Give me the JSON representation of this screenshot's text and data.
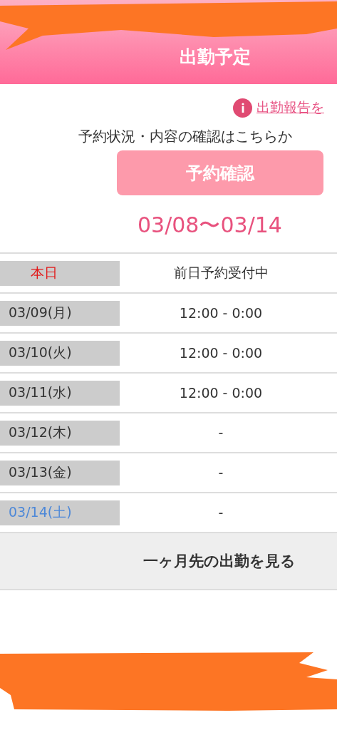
{
  "header": {
    "title": "出勤予定"
  },
  "notice": {
    "link": "出勤報告を"
  },
  "reservation": {
    "text": "予約状況・内容の確認はこちらか",
    "button": "予約確認"
  },
  "week_range": "03/08〜03/14",
  "schedule": [
    {
      "kind": "today",
      "date": "本日",
      "time": "前日予約受付中"
    },
    {
      "kind": "weekday",
      "date": "03/09(月)",
      "time": "12:00 - 0:00"
    },
    {
      "kind": "weekday",
      "date": "03/10(火)",
      "time": "12:00 - 0:00"
    },
    {
      "kind": "weekday",
      "date": "03/11(水)",
      "time": "12:00 - 0:00"
    },
    {
      "kind": "weekday",
      "date": "03/12(木)",
      "time": "-"
    },
    {
      "kind": "weekday",
      "date": "03/13(金)",
      "time": "-"
    },
    {
      "kind": "saturday",
      "date": "03/14(土)",
      "time": "-"
    }
  ],
  "more_button": "一ヶ月先の出勤を見る"
}
